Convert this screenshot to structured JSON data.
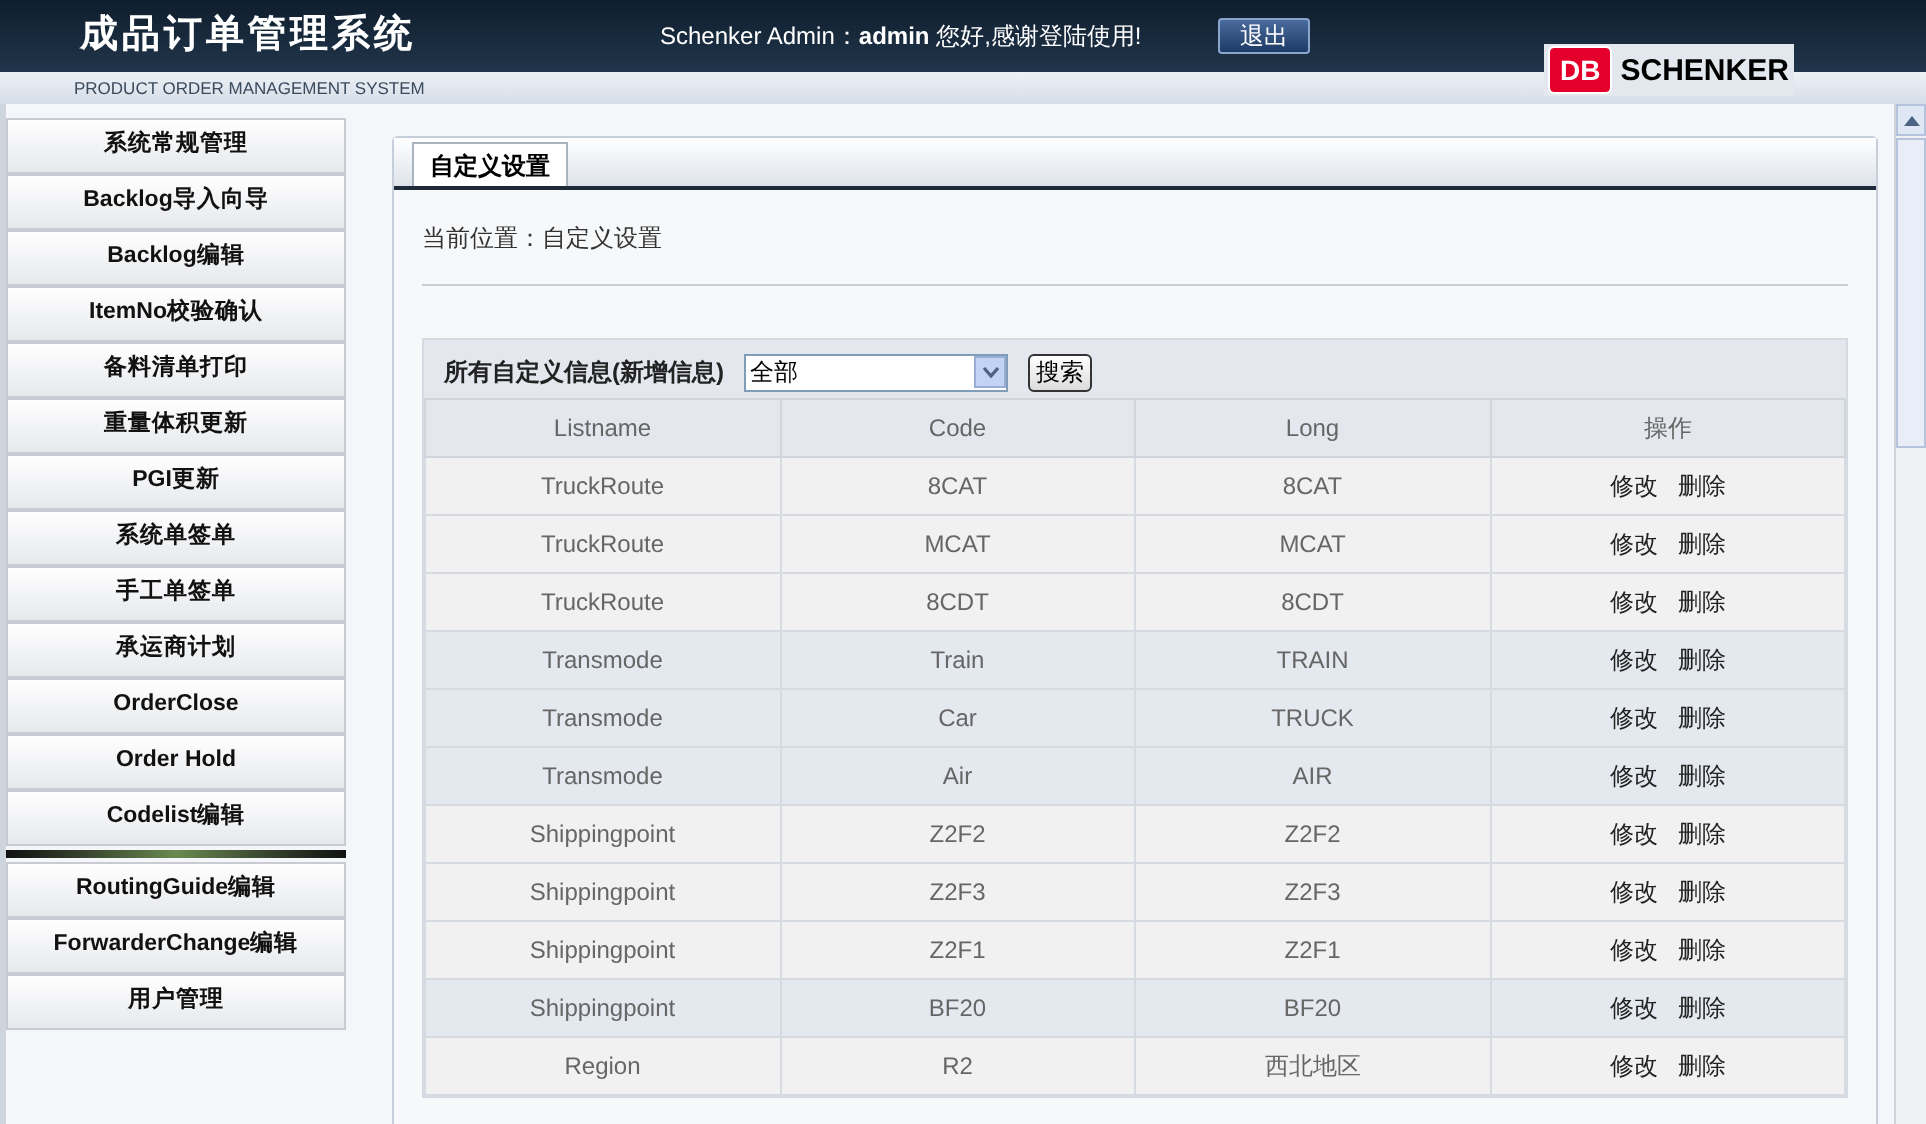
{
  "header": {
    "title": "成品订单管理系统",
    "subtitle": "PRODUCT ORDER MANAGEMENT SYSTEM",
    "user_label": "Schenker Admin：",
    "username": "admin",
    "greeting": "您好,感谢登陆使用!",
    "logout_button": "退出",
    "logo_mark": "DB",
    "logo_text": "SCHENKER"
  },
  "sidebar": {
    "items": [
      {
        "label": "系统常规管理",
        "divider_after": false
      },
      {
        "label": "Backlog导入向导",
        "divider_after": false
      },
      {
        "label": "Backlog编辑",
        "divider_after": false
      },
      {
        "label": "ItemNo校验确认",
        "divider_after": false
      },
      {
        "label": "备料清单打印",
        "divider_after": false
      },
      {
        "label": "重量体积更新",
        "divider_after": false
      },
      {
        "label": "PGI更新",
        "divider_after": false
      },
      {
        "label": "系统单签单",
        "divider_after": false
      },
      {
        "label": "手工单签单",
        "divider_after": false
      },
      {
        "label": "承运商计划",
        "divider_after": false
      },
      {
        "label": "OrderClose",
        "divider_after": false
      },
      {
        "label": "Order Hold",
        "divider_after": false
      },
      {
        "label": "Codelist编辑",
        "divider_after": true
      },
      {
        "label": "RoutingGuide编辑",
        "divider_after": false
      },
      {
        "label": "ForwarderChange编辑",
        "divider_after": false
      },
      {
        "label": "用户管理",
        "divider_after": false
      }
    ]
  },
  "tabs": [
    {
      "label": "自定义设置",
      "selected": true
    }
  ],
  "breadcrumb": "当前位置：自定义设置",
  "filter": {
    "label": "所有自定义信息(新增信息)",
    "value": "全部",
    "search_button": "搜索"
  },
  "table": {
    "columns": [
      "Listname",
      "Code",
      "Long",
      "操作"
    ],
    "rows": [
      {
        "cells": [
          "TruckRoute",
          "8CAT",
          "8CAT"
        ],
        "actions": [
          "修改",
          "删除"
        ],
        "shaded": false
      },
      {
        "cells": [
          "TruckRoute",
          "MCAT",
          "MCAT"
        ],
        "actions": [
          "修改",
          "删除"
        ],
        "shaded": false
      },
      {
        "cells": [
          "TruckRoute",
          "8CDT",
          "8CDT"
        ],
        "actions": [
          "修改",
          "删除"
        ],
        "shaded": false
      },
      {
        "cells": [
          "Transmode",
          "Train",
          "TRAIN"
        ],
        "actions": [
          "修改",
          "删除"
        ],
        "shaded": true
      },
      {
        "cells": [
          "Transmode",
          "Car",
          "TRUCK"
        ],
        "actions": [
          "修改",
          "删除"
        ],
        "shaded": true
      },
      {
        "cells": [
          "Transmode",
          "Air",
          "AIR"
        ],
        "actions": [
          "修改",
          "删除"
        ],
        "shaded": true
      },
      {
        "cells": [
          "Shippingpoint",
          "Z2F2",
          "Z2F2"
        ],
        "actions": [
          "修改",
          "删除"
        ],
        "shaded": false
      },
      {
        "cells": [
          "Shippingpoint",
          "Z2F3",
          "Z2F3"
        ],
        "actions": [
          "修改",
          "删除"
        ],
        "shaded": false
      },
      {
        "cells": [
          "Shippingpoint",
          "Z2F1",
          "Z2F1"
        ],
        "actions": [
          "修改",
          "删除"
        ],
        "shaded": false
      },
      {
        "cells": [
          "Shippingpoint",
          "BF20",
          "BF20"
        ],
        "actions": [
          "修改",
          "删除"
        ],
        "shaded": true
      },
      {
        "cells": [
          "Region",
          "R2",
          "西北地区"
        ],
        "actions": [
          "修改",
          "删除"
        ],
        "shaded": false
      }
    ]
  }
}
